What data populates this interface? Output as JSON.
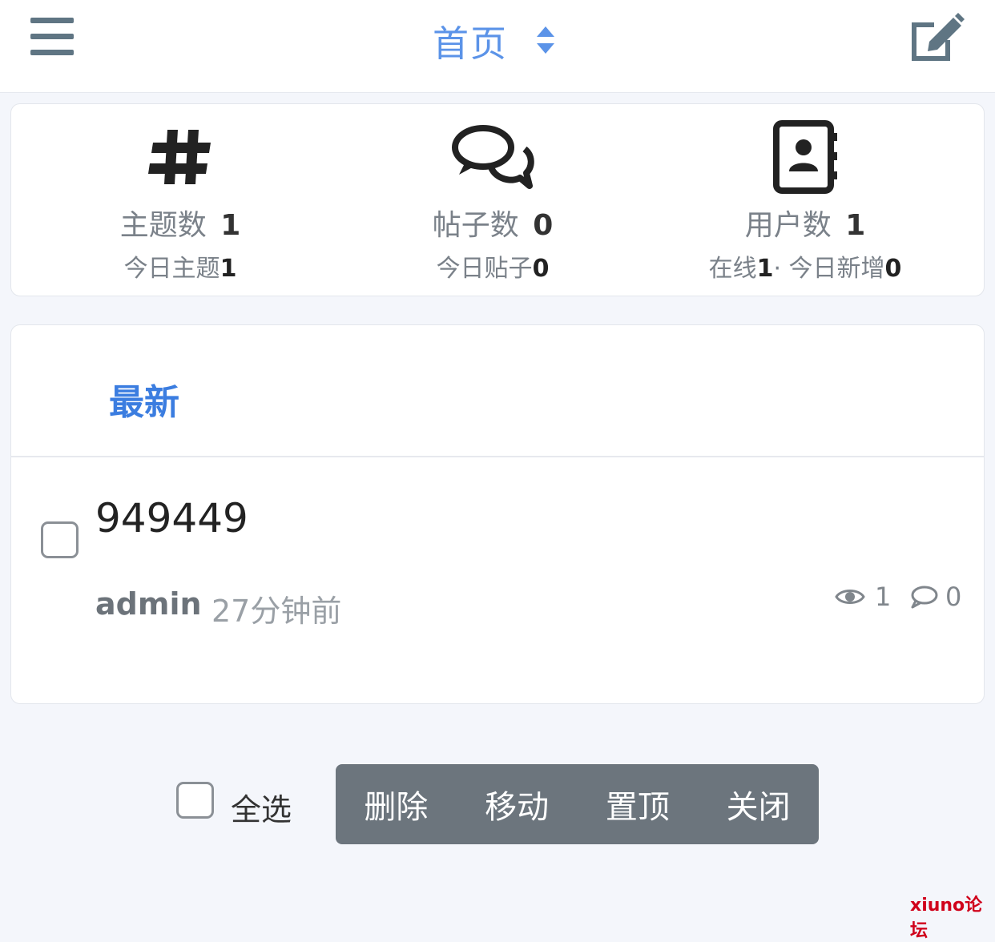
{
  "header": {
    "title": "首页",
    "menu_icon": "menu-icon",
    "sort_icon": "sort-icon",
    "compose_icon": "compose-icon"
  },
  "stats": [
    {
      "icon": "hashtag-icon",
      "label": "主题数",
      "value": "1",
      "sub_label": "今日主题",
      "sub_value": "1"
    },
    {
      "icon": "comments-icon",
      "label": "帖子数",
      "value": "0",
      "sub_label": "今日贴子",
      "sub_value": "0"
    },
    {
      "icon": "address-book-icon",
      "label": "用户数",
      "value": "1",
      "sub_online_label": "在线",
      "sub_online_value": "1",
      "sub_sep": "· ",
      "sub_label": "今日新增",
      "sub_value": "0"
    }
  ],
  "tabs": {
    "latest": "最新"
  },
  "threads": [
    {
      "title": "949449",
      "author": "admin",
      "time": "27分钟前",
      "views": "1",
      "replies": "0"
    }
  ],
  "mod_bar": {
    "select_all": "全选",
    "actions": [
      "删除",
      "移动",
      "置顶",
      "关闭"
    ]
  },
  "watermark": "xiuno论坛",
  "colors": {
    "accent": "#3b7de0",
    "title_blue": "#5b93e8",
    "icon_slate": "#5f7583",
    "action_bar": "#6c757d",
    "watermark": "#d0021b"
  }
}
